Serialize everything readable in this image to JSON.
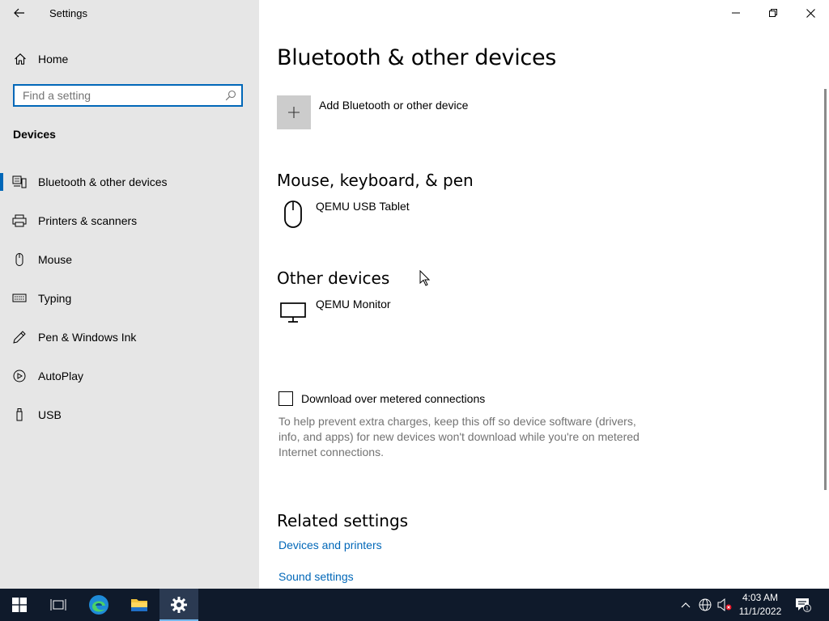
{
  "window": {
    "title": "Settings",
    "back_label": "Back",
    "minimize_label": "Minimize",
    "restore_label": "Restore Down",
    "close_label": "Close"
  },
  "sidebar": {
    "home_label": "Home",
    "search_placeholder": "Find a setting",
    "search_value": "",
    "section_title": "Devices",
    "items": [
      {
        "label": "Bluetooth & other devices",
        "icon": "bluetooth-devices-icon",
        "selected": true
      },
      {
        "label": "Printers & scanners",
        "icon": "printer-icon",
        "selected": false
      },
      {
        "label": "Mouse",
        "icon": "mouse-icon",
        "selected": false
      },
      {
        "label": "Typing",
        "icon": "keyboard-icon",
        "selected": false
      },
      {
        "label": "Pen & Windows Ink",
        "icon": "pen-icon",
        "selected": false
      },
      {
        "label": "AutoPlay",
        "icon": "autoplay-icon",
        "selected": false
      },
      {
        "label": "USB",
        "icon": "usb-icon",
        "selected": false
      }
    ]
  },
  "main": {
    "title": "Bluetooth & other devices",
    "add_device_label": "Add Bluetooth or other device",
    "groups": [
      {
        "title": "Mouse, keyboard, & pen",
        "devices": [
          {
            "name": "QEMU USB Tablet",
            "icon": "mouse-icon"
          }
        ]
      },
      {
        "title": "Other devices",
        "devices": [
          {
            "name": "QEMU Monitor",
            "icon": "monitor-icon"
          }
        ]
      }
    ],
    "metered": {
      "label": "Download over metered connections",
      "checked": false,
      "description": "To help prevent extra charges, keep this off so device software (drivers, info, and apps) for new devices won't download while you're on metered Internet connections."
    },
    "related": {
      "title": "Related settings",
      "links": [
        "Devices and printers",
        "Sound settings"
      ]
    }
  },
  "taskbar": {
    "apps": [
      "start-icon",
      "task-view-icon",
      "edge-icon",
      "file-explorer-icon",
      "settings-icon"
    ],
    "time": "4:03 AM",
    "date": "11/1/2022",
    "notification_count": "1"
  },
  "colors": {
    "accent": "#0067b8",
    "sidebar_bg": "#e6e6e6",
    "taskbar_bg": "#0f1a2b",
    "muted_text": "#737373"
  }
}
